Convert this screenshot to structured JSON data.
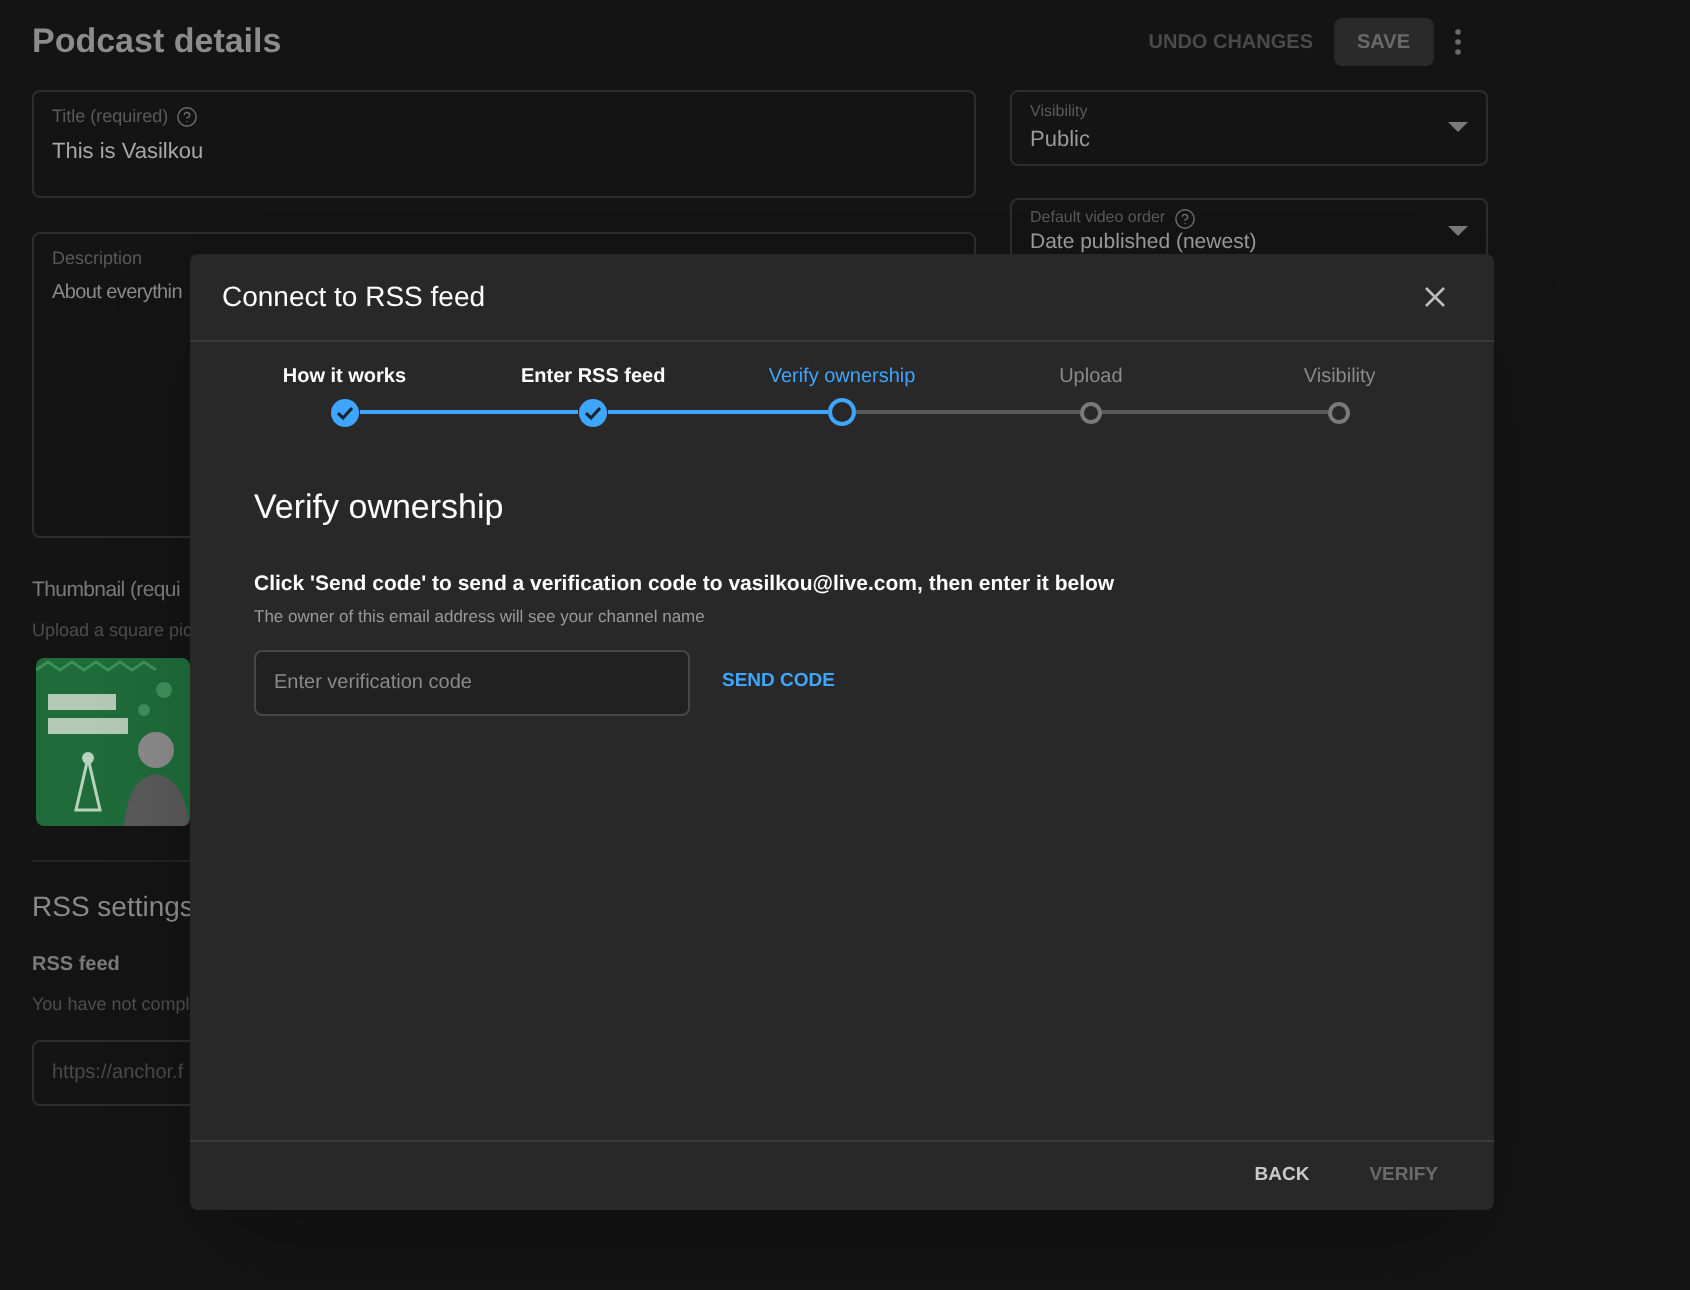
{
  "page": {
    "title": "Podcast details",
    "actions": [
      {
        "kind": "text",
        "label": "UNDO CHANGES"
      },
      {
        "kind": "filled",
        "label": "SAVE"
      }
    ],
    "title_field": {
      "label": "Title (required)",
      "value": "This is Vasilkou"
    },
    "description_field": {
      "label": "Description",
      "value": "About everythin"
    },
    "thumbnail": {
      "heading": "Thumbnail (requi",
      "hint": "Upload a square pic"
    },
    "rss": {
      "heading": "RSS settings",
      "label": "RSS feed",
      "hint": "You have not compl",
      "placeholder": "https://anchor.f"
    },
    "visibility_select": {
      "label": "Visibility",
      "value": "Public"
    },
    "order_select": {
      "label": "Default video order",
      "value": "Date published (newest)"
    }
  },
  "dialog": {
    "title": "Connect to RSS feed",
    "steps": [
      {
        "label": "How it works",
        "done": true,
        "selected": false
      },
      {
        "label": "Enter RSS feed",
        "done": true,
        "selected": false
      },
      {
        "label": "Verify ownership",
        "done": false,
        "selected": true
      },
      {
        "label": "Upload",
        "done": false,
        "selected": false
      },
      {
        "label": "Visibility",
        "done": false,
        "selected": false
      }
    ],
    "heading": "Verify ownership",
    "instruction": "Click 'Send code' to send a verification code to vasilkou@live.com, then enter it below",
    "note": "The owner of this email address will see your channel name",
    "code_field": {
      "placeholder": "Enter verification code"
    },
    "send_button": "SEND CODE",
    "buttons": [
      {
        "label": "BACK",
        "disabled": false
      },
      {
        "label": "VERIFY",
        "disabled": true
      }
    ]
  }
}
